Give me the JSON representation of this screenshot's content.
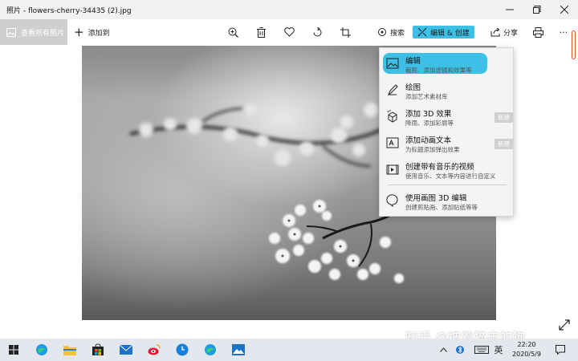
{
  "window": {
    "title": "照片 - flowers-cherry-34435 (2).jpg",
    "minimize_icon": "minimize-icon",
    "maximize_icon": "maximize-icon",
    "close_icon": "close-icon"
  },
  "toolbar": {
    "see_all_label": "查看所有照片",
    "add_to_label": "添加到",
    "search_label": "搜索",
    "edit_create_label": "编辑 & 创建",
    "share_label": "分享",
    "more_label": "···",
    "accent_color": "#3cc0e6"
  },
  "menu": {
    "items": [
      {
        "title": "编辑",
        "subtitle": "裁剪、添加滤镜和效果等",
        "icon": "image-edit-icon"
      },
      {
        "title": "绘图",
        "subtitle": "添加艺术素材库",
        "icon": "pen-icon"
      },
      {
        "title": "添加 3D 效果",
        "subtitle": "降雨、添加彩屑等",
        "icon": "3d-effects-icon",
        "badge": "新建"
      },
      {
        "title": "添加动画文本",
        "subtitle": "为标题添加弹出效果",
        "icon": "animated-text-icon",
        "badge": "新建"
      },
      {
        "title": "创建带有音乐的视频",
        "subtitle": "使用音乐、文本等内容进行自定义",
        "icon": "video-icon"
      },
      {
        "title": "使用画图 3D 编辑",
        "subtitle": "创建剪贴画、添加贴纸等等",
        "icon": "paint3d-icon"
      }
    ]
  },
  "watermark": "知乎 @披着猫皮的狗",
  "taskbar": {
    "ime_label": "英",
    "time": "22:20",
    "date": "2020/5/9"
  }
}
